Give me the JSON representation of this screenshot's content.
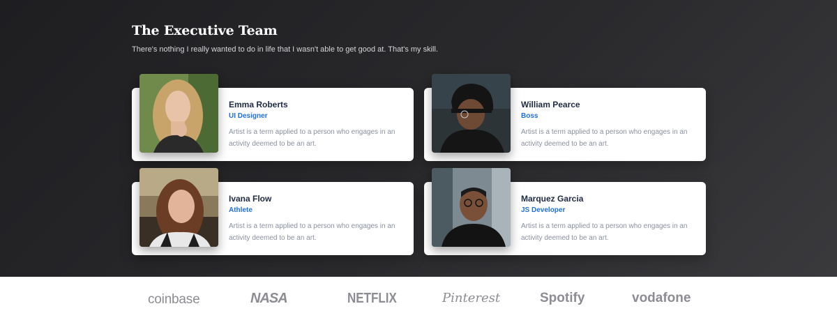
{
  "section": {
    "title": "The Executive Team",
    "subtitle": "There's nothing I really wanted to do in life that I wasn't able to get good at. That's my skill."
  },
  "team": [
    {
      "name": "Emma Roberts",
      "role": "UI Designer",
      "description": "Artist is a term applied to a person who engages in an activity deemed to be an art."
    },
    {
      "name": "William Pearce",
      "role": "Boss",
      "description": "Artist is a term applied to a person who engages in an activity deemed to be an art."
    },
    {
      "name": "Ivana Flow",
      "role": "Athlete",
      "description": "Artist is a term applied to a person who engages in an activity deemed to be an art."
    },
    {
      "name": "Marquez Garcia",
      "role": "JS Developer",
      "description": "Artist is a term applied to a person who engages in an activity deemed to be an art."
    }
  ],
  "brands": [
    "coinbase",
    "NASA",
    "NETFLIX",
    "Pinterest",
    "Spotify",
    "vodafone"
  ],
  "colors": {
    "accent": "#1f6fe0",
    "name_text": "#1e2a44",
    "muted_text": "#8a90a0",
    "brand_gray": "#8c8c92"
  }
}
